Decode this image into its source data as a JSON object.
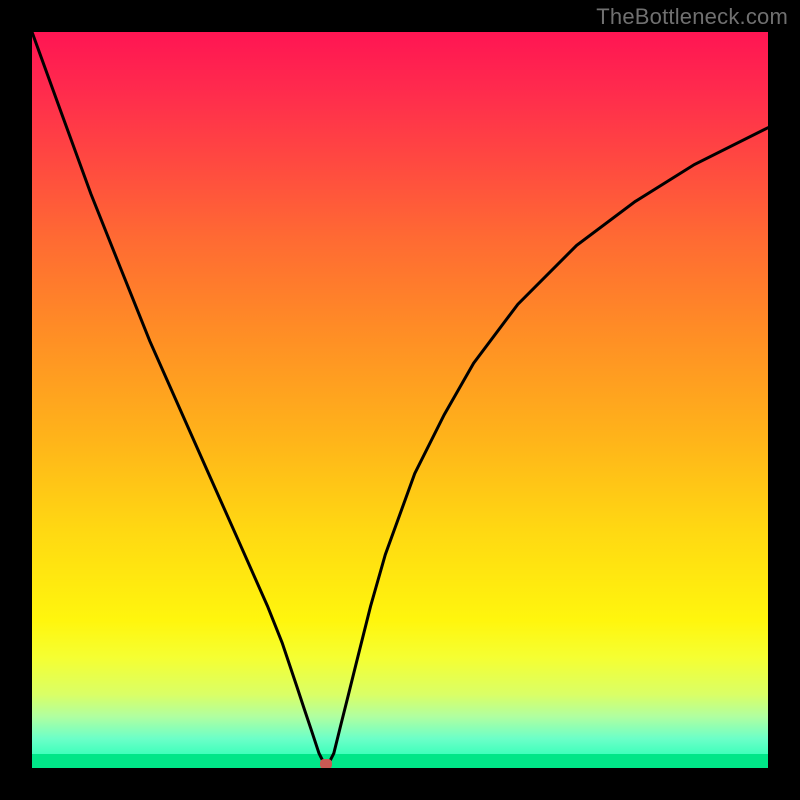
{
  "watermark": "TheBottleneck.com",
  "chart_data": {
    "type": "line",
    "title": "",
    "xlabel": "",
    "ylabel": "",
    "xlim": [
      0,
      100
    ],
    "ylim": [
      0,
      100
    ],
    "series": [
      {
        "name": "bottleneck-curve",
        "x": [
          0,
          4,
          8,
          12,
          16,
          20,
          24,
          28,
          32,
          34,
          36,
          37,
          38,
          39,
          40,
          41,
          42,
          43,
          44,
          46,
          48,
          52,
          56,
          60,
          66,
          74,
          82,
          90,
          100
        ],
        "y": [
          100,
          89,
          78,
          68,
          58,
          49,
          40,
          31,
          22,
          17,
          11,
          8,
          5,
          2,
          0,
          2,
          6,
          10,
          14,
          22,
          29,
          40,
          48,
          55,
          63,
          71,
          77,
          82,
          87
        ]
      }
    ],
    "marker": {
      "x": 40,
      "y": 0,
      "name": "optimal-point"
    },
    "background_gradient": {
      "stops": [
        {
          "pos": 0.0,
          "color": "#ff1553"
        },
        {
          "pos": 0.5,
          "color": "#ffb31a"
        },
        {
          "pos": 0.8,
          "color": "#fff60d"
        },
        {
          "pos": 1.0,
          "color": "#17ffb0"
        }
      ]
    }
  }
}
